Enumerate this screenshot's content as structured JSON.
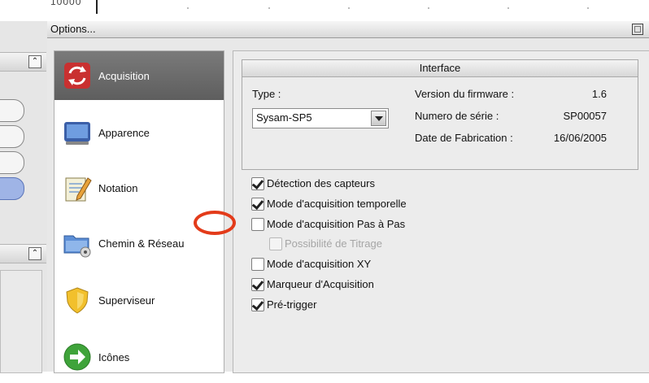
{
  "background": {
    "value_readout": "10000"
  },
  "dialog": {
    "title": "Options..."
  },
  "nav": {
    "items": [
      {
        "label": "Acquisition",
        "icon": "refresh-arrows-icon",
        "active": true
      },
      {
        "label": "Apparence",
        "icon": "monitor-icon",
        "active": false
      },
      {
        "label": "Notation",
        "icon": "notepad-pencil-icon",
        "active": false
      },
      {
        "label": "Chemin & Réseau",
        "icon": "folder-network-icon",
        "active": false
      },
      {
        "label": "Superviseur",
        "icon": "shield-icon",
        "active": false
      },
      {
        "label": "Icônes",
        "icon": "arrow-right-icon",
        "active": false
      }
    ]
  },
  "interface": {
    "header": "Interface",
    "type_label": "Type :",
    "type_value": "Sysam-SP5",
    "firmware_label": "Version du firmware :",
    "firmware_value": "1.6",
    "serial_label": "Numero de série :",
    "serial_value": "SP00057",
    "date_label": "Date de Fabrication :",
    "date_value": "16/06/2005"
  },
  "options": [
    {
      "label": "Détection des capteurs",
      "checked": true,
      "disabled": false
    },
    {
      "label": "Mode d'acquisition temporelle",
      "checked": true,
      "disabled": false
    },
    {
      "label": "Mode d'acquisition Pas à Pas",
      "checked": false,
      "disabled": false
    },
    {
      "label": "Possibilité de Titrage",
      "checked": false,
      "disabled": true
    },
    {
      "label": "Mode d'acquisition XY",
      "checked": false,
      "disabled": false
    },
    {
      "label": "Marqueur d'Acquisition",
      "checked": true,
      "disabled": false
    },
    {
      "label": "Pré-trigger",
      "checked": true,
      "disabled": false
    }
  ],
  "colors": {
    "annotation_circle": "#e33b1a",
    "active_nav_bg": "#6b6b6b"
  }
}
